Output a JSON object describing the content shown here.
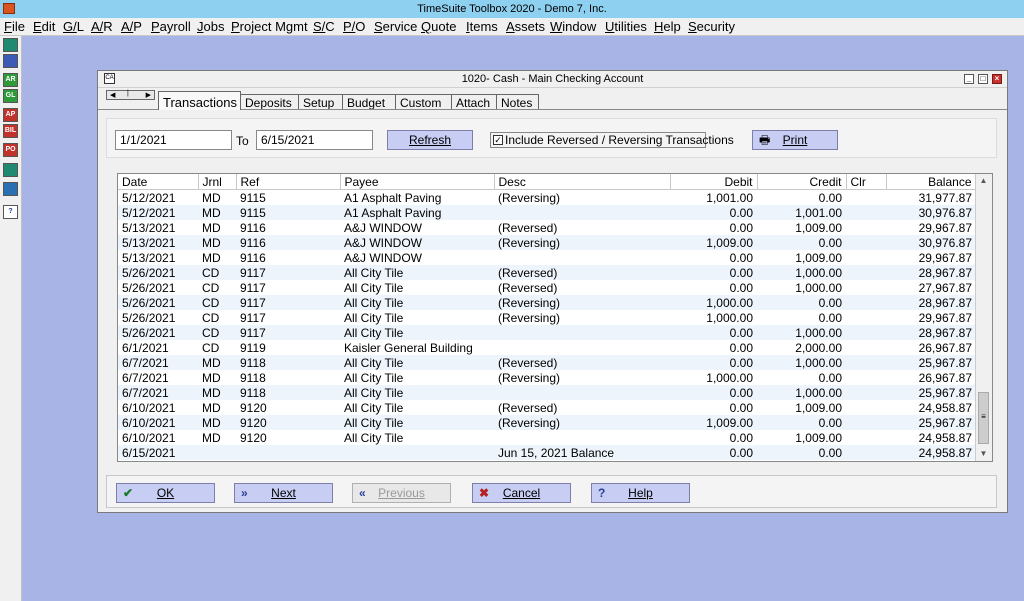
{
  "app": {
    "title": "TimeSuite Toolbox 2020 - Demo 7, Inc."
  },
  "menu": [
    "File",
    "Edit",
    "G/L",
    "A/R",
    "A/P",
    "Payroll",
    "Jobs",
    "Project Mgmt",
    "S/C",
    "P/O",
    "Service",
    "Quote",
    "Items",
    "Assets",
    "Window",
    "Utilities",
    "Help",
    "Security"
  ],
  "toolbar": {
    "buttons": [
      {
        "icon": "computer-icon",
        "label": "",
        "color": "#1f8a6f"
      },
      {
        "icon": "checklist-icon",
        "label": "",
        "color": "#3b5bb5"
      },
      {
        "icon": "ar-ledger-icon",
        "label": "AR",
        "color": "#2e9a3a"
      },
      {
        "icon": "gl-ledger-icon",
        "label": "GL",
        "color": "#2e9a3a"
      },
      {
        "icon": "ap-ledger-icon",
        "label": "AP",
        "color": "#c0322a"
      },
      {
        "icon": "bill-icon",
        "label": "BIL",
        "color": "#c0322a"
      },
      {
        "icon": "po-icon",
        "label": "PO",
        "color": "#c0322a"
      },
      {
        "icon": "terminal-icon",
        "label": "",
        "color": "#1f8a6f"
      },
      {
        "icon": "worker-icon",
        "label": "",
        "color": "#2b6fb3"
      },
      {
        "icon": "help-icon",
        "label": "?",
        "color": "#ffffff"
      }
    ]
  },
  "window": {
    "title": "1020- Cash - Main Checking Account",
    "sys_icon": "CA",
    "tabs": [
      "Transactions",
      "Deposits",
      "Setup",
      "Budget",
      "Custom",
      "Attach",
      "Notes"
    ],
    "active_tab": "Transactions"
  },
  "filter": {
    "from_date": "1/1/2021",
    "to_label": "To",
    "to_date": "6/15/2021",
    "refresh_label": "Refresh",
    "include_reversed_label": "Include Reversed / Reversing Transactions",
    "include_reversed_checked": true,
    "print_label": "Print"
  },
  "table": {
    "columns": [
      "Date",
      "Jrnl",
      "Ref",
      "Payee",
      "Desc",
      "Debit",
      "Credit",
      "Clr",
      "Balance"
    ],
    "rows": [
      [
        "5/12/2021",
        "MD",
        "9115",
        "A1 Asphalt Paving",
        "(Reversing)",
        "1,001.00",
        "0.00",
        "",
        "31,977.87"
      ],
      [
        "5/12/2021",
        "MD",
        "9115",
        "A1 Asphalt Paving",
        "",
        "0.00",
        "1,001.00",
        "",
        "30,976.87"
      ],
      [
        "5/13/2021",
        "MD",
        "9116",
        "A&J WINDOW",
        "(Reversed)",
        "0.00",
        "1,009.00",
        "",
        "29,967.87"
      ],
      [
        "5/13/2021",
        "MD",
        "9116",
        "A&J WINDOW",
        "(Reversing)",
        "1,009.00",
        "0.00",
        "",
        "30,976.87"
      ],
      [
        "5/13/2021",
        "MD",
        "9116",
        "A&J WINDOW",
        "",
        "0.00",
        "1,009.00",
        "",
        "29,967.87"
      ],
      [
        "5/26/2021",
        "CD",
        "9117",
        "All City Tile",
        "(Reversed)",
        "0.00",
        "1,000.00",
        "",
        "28,967.87"
      ],
      [
        "5/26/2021",
        "CD",
        "9117",
        "All City Tile",
        "(Reversed)",
        "0.00",
        "1,000.00",
        "",
        "27,967.87"
      ],
      [
        "5/26/2021",
        "CD",
        "9117",
        "All City Tile",
        "(Reversing)",
        "1,000.00",
        "0.00",
        "",
        "28,967.87"
      ],
      [
        "5/26/2021",
        "CD",
        "9117",
        "All City Tile",
        "(Reversing)",
        "1,000.00",
        "0.00",
        "",
        "29,967.87"
      ],
      [
        "5/26/2021",
        "CD",
        "9117",
        "All City Tile",
        "",
        "0.00",
        "1,000.00",
        "",
        "28,967.87"
      ],
      [
        "6/1/2021",
        "CD",
        "9119",
        "Kaisler General Building",
        "",
        "0.00",
        "2,000.00",
        "",
        "26,967.87"
      ],
      [
        "6/7/2021",
        "MD",
        "9118",
        "All City Tile",
        "(Reversed)",
        "0.00",
        "1,000.00",
        "",
        "25,967.87"
      ],
      [
        "6/7/2021",
        "MD",
        "9118",
        "All City Tile",
        "(Reversing)",
        "1,000.00",
        "0.00",
        "",
        "26,967.87"
      ],
      [
        "6/7/2021",
        "MD",
        "9118",
        "All City Tile",
        "",
        "0.00",
        "1,000.00",
        "",
        "25,967.87"
      ],
      [
        "6/10/2021",
        "MD",
        "9120",
        "All City Tile",
        "(Reversed)",
        "0.00",
        "1,009.00",
        "",
        "24,958.87"
      ],
      [
        "6/10/2021",
        "MD",
        "9120",
        "All City Tile",
        "(Reversing)",
        "1,009.00",
        "0.00",
        "",
        "25,967.87"
      ],
      [
        "6/10/2021",
        "MD",
        "9120",
        "All City Tile",
        "",
        "0.00",
        "1,009.00",
        "",
        "24,958.87"
      ],
      [
        "6/15/2021",
        "",
        "",
        "",
        "Jun 15, 2021 Balance",
        "0.00",
        "0.00",
        "",
        "24,958.87"
      ]
    ]
  },
  "footer": {
    "ok_label": "OK",
    "next_label": "Next",
    "previous_label": "Previous",
    "cancel_label": "Cancel",
    "help_label": "Help"
  },
  "colors": {
    "desktop": "#a9b4e6",
    "titlebar": "#8ed0ef",
    "button": "#c7cdf3",
    "row_alt": "#eef4fb"
  }
}
